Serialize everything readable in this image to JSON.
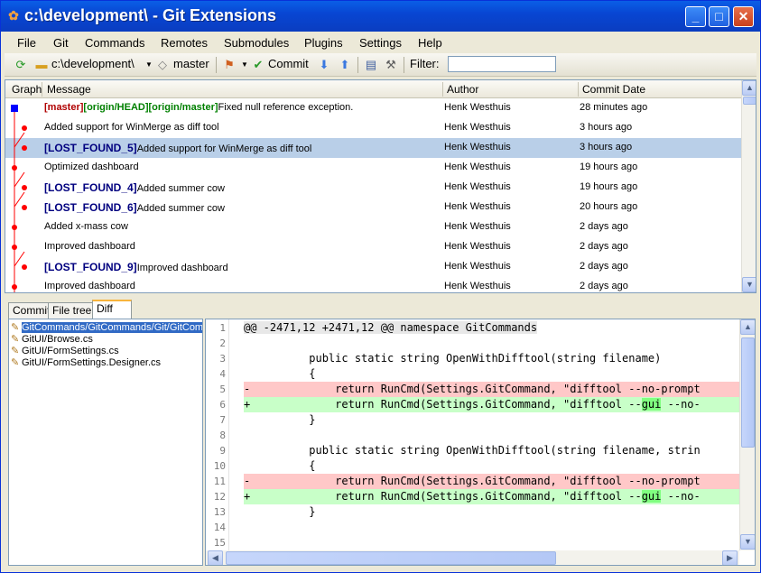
{
  "window": {
    "title": "c:\\development\\ - Git Extensions"
  },
  "menu": [
    "File",
    "Git",
    "Commands",
    "Remotes",
    "Submodules",
    "Plugins",
    "Settings",
    "Help"
  ],
  "toolbar": {
    "path": "c:\\development\\",
    "branch": "master",
    "commit_label": "Commit",
    "filter_label": "Filter:",
    "filter_value": ""
  },
  "grid": {
    "columns": {
      "graph": "Graph",
      "message": "Message",
      "author": "Author",
      "date": "Commit Date"
    },
    "rows": [
      {
        "refs": [
          {
            "t": "[master]",
            "c": "red"
          },
          {
            "t": "[origin/HEAD]",
            "c": "green"
          },
          {
            "t": "[origin/master]",
            "c": "green"
          }
        ],
        "message": "Fixed null reference exception.",
        "author": "Henk Westhuis",
        "date": "28 minutes ago"
      },
      {
        "refs": [],
        "message": "Added support for WinMerge as diff tool",
        "author": "Henk Westhuis",
        "date": "3 hours ago"
      },
      {
        "refs": [
          {
            "t": "[LOST_FOUND_5]",
            "c": "blue"
          }
        ],
        "message": "Added support for WinMerge as diff tool",
        "author": "Henk Westhuis",
        "date": "3 hours ago",
        "selected": true
      },
      {
        "refs": [],
        "message": "Optimized dashboard",
        "author": "Henk Westhuis",
        "date": "19 hours ago"
      },
      {
        "refs": [
          {
            "t": "[LOST_FOUND_4]",
            "c": "blue"
          }
        ],
        "message": "Added summer cow",
        "author": "Henk Westhuis",
        "date": "19 hours ago"
      },
      {
        "refs": [
          {
            "t": "[LOST_FOUND_6]",
            "c": "blue"
          }
        ],
        "message": "Added summer cow",
        "author": "Henk Westhuis",
        "date": "20 hours ago"
      },
      {
        "refs": [],
        "message": "Added x-mass cow",
        "author": "Henk Westhuis",
        "date": "2 days ago"
      },
      {
        "refs": [],
        "message": "Improved dashboard",
        "author": "Henk Westhuis",
        "date": "2 days ago"
      },
      {
        "refs": [
          {
            "t": "[LOST_FOUND_9]",
            "c": "blue"
          }
        ],
        "message": "Improved dashboard",
        "author": "Henk Westhuis",
        "date": "2 days ago"
      },
      {
        "refs": [],
        "message": "Improved dashboard",
        "author": "Henk Westhuis",
        "date": "2 days ago"
      }
    ]
  },
  "tabs": [
    "Commit",
    "File tree",
    "Diff"
  ],
  "active_tab": "Diff",
  "files": [
    {
      "name": "GitCommands/GitCommands/Git/GitCommands.cs",
      "selected": true
    },
    {
      "name": "GitUI/Browse.cs"
    },
    {
      "name": "GitUI/FormSettings.cs"
    },
    {
      "name": "GitUI/FormSettings.Designer.cs"
    }
  ],
  "diff": {
    "lines": [
      {
        "n": "1",
        "type": "hdr",
        "pre": "@@ -2471,12 +2471,12 @@ namespace GitCommands",
        "hl": "",
        "post": ""
      },
      {
        "n": "2",
        "type": "ctx",
        "pre": "",
        "hl": "",
        "post": ""
      },
      {
        "n": "3",
        "type": "ctx",
        "pre": "          public static string OpenWithDifftool(string filename)",
        "hl": "",
        "post": ""
      },
      {
        "n": "4",
        "type": "ctx",
        "pre": "          {",
        "hl": "",
        "post": ""
      },
      {
        "n": "5",
        "type": "rem",
        "pre": "-             return RunCmd(Settings.GitCommand, \"difftool --no-prompt",
        "hl": "",
        "post": ""
      },
      {
        "n": "6",
        "type": "add",
        "pre": "+             return RunCmd(Settings.GitCommand, \"difftool --",
        "hl": "gui",
        "post": " --no-"
      },
      {
        "n": "7",
        "type": "ctx",
        "pre": "          }",
        "hl": "",
        "post": ""
      },
      {
        "n": "8",
        "type": "ctx",
        "pre": "",
        "hl": "",
        "post": ""
      },
      {
        "n": "9",
        "type": "ctx",
        "pre": "          public static string OpenWithDifftool(string filename, strin",
        "hl": "",
        "post": ""
      },
      {
        "n": "10",
        "type": "ctx",
        "pre": "          {",
        "hl": "",
        "post": ""
      },
      {
        "n": "11",
        "type": "rem",
        "pre": "-             return RunCmd(Settings.GitCommand, \"difftool --no-prompt",
        "hl": "",
        "post": ""
      },
      {
        "n": "12",
        "type": "add",
        "pre": "+             return RunCmd(Settings.GitCommand, \"difftool --",
        "hl": "gui",
        "post": " --no-"
      },
      {
        "n": "13",
        "type": "ctx",
        "pre": "          }",
        "hl": "",
        "post": ""
      },
      {
        "n": "14",
        "type": "ctx",
        "pre": "",
        "hl": "",
        "post": ""
      },
      {
        "n": "15",
        "type": "ctx",
        "pre": "",
        "hl": "",
        "post": ""
      }
    ]
  }
}
